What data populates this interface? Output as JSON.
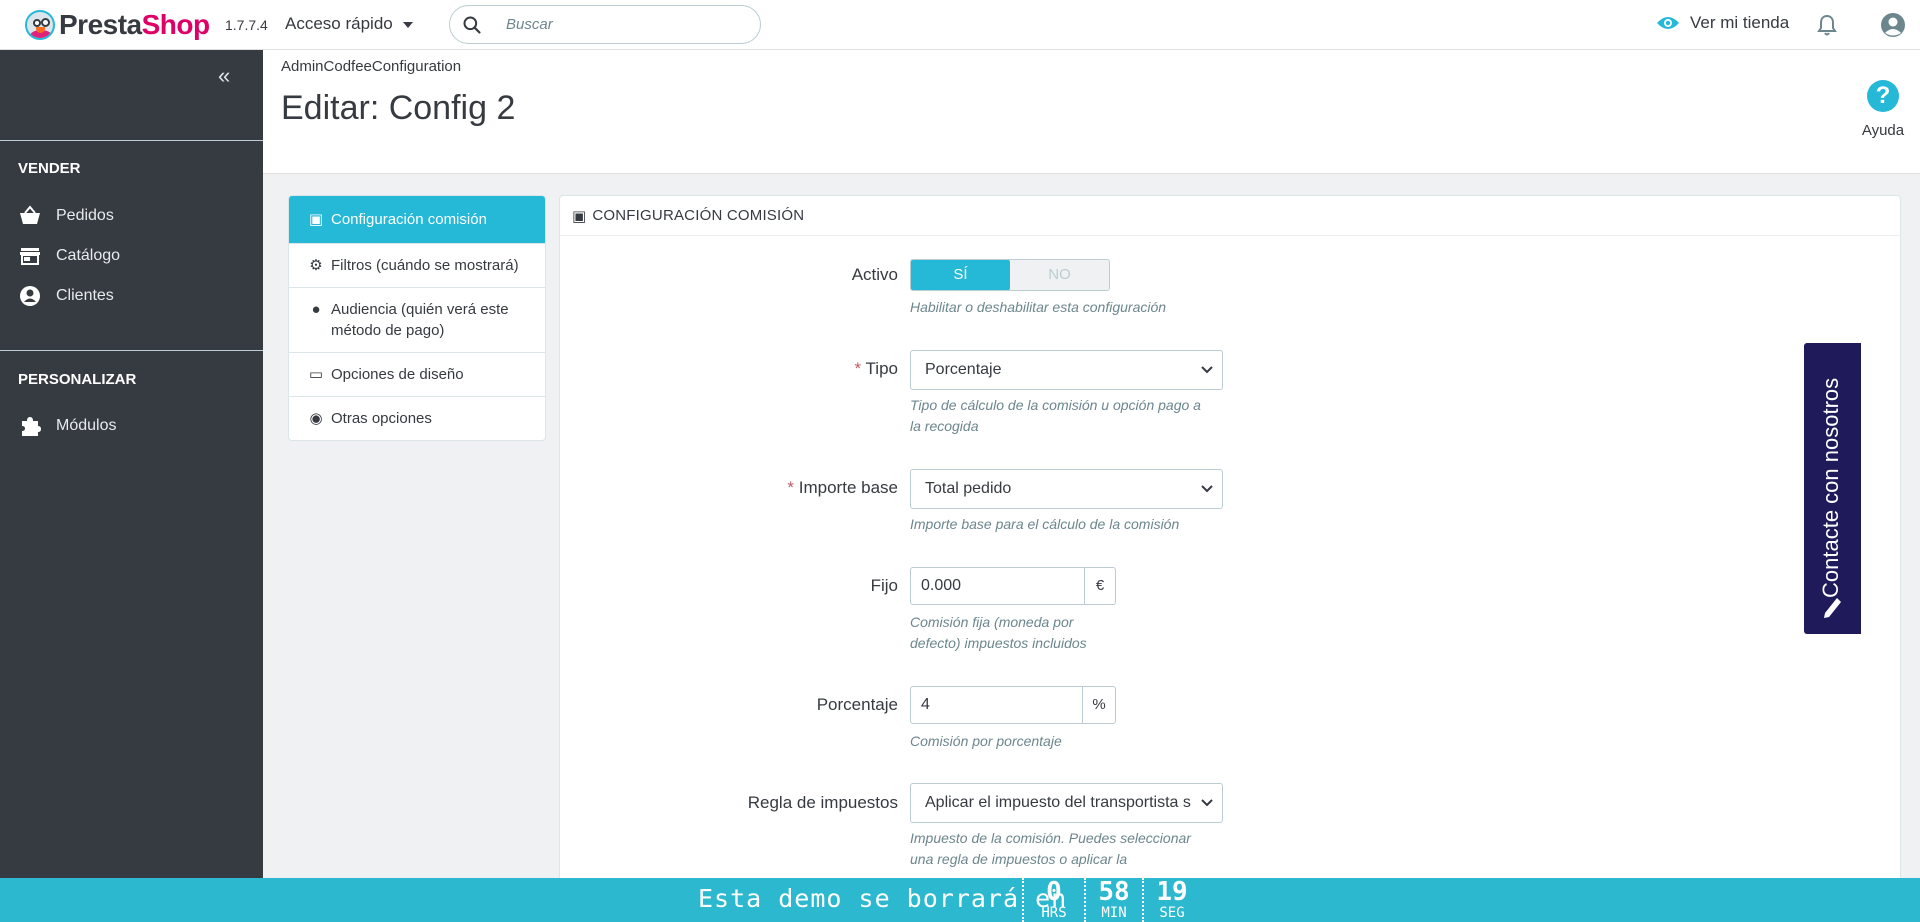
{
  "header": {
    "brand_part1": "Presta",
    "brand_part2": "Shop",
    "version": "1.7.7.4",
    "quick_access": "Acceso rápido",
    "search_placeholder": "Buscar",
    "view_shop": "Ver mi tienda"
  },
  "sidebar": {
    "section_sell": "VENDER",
    "items_sell": [
      {
        "label": "Pedidos",
        "icon": "basket-icon"
      },
      {
        "label": "Catálogo",
        "icon": "store-icon"
      },
      {
        "label": "Clientes",
        "icon": "account-icon"
      }
    ],
    "section_custom": "PERSONALIZAR",
    "items_custom": [
      {
        "label": "Módulos",
        "icon": "puzzle-icon"
      }
    ]
  },
  "page": {
    "breadcrumb": "AdminCodfeeConfiguration",
    "title": "Editar: Config 2",
    "help_label": "Ayuda"
  },
  "tabs": [
    {
      "label": "Configuración comisión",
      "active": true
    },
    {
      "label": "Filtros (cuándo se mostrará)",
      "active": false
    },
    {
      "label": "Audiencia (quién verá este método de pago)",
      "active": false
    },
    {
      "label": "Opciones de diseño",
      "active": false
    },
    {
      "label": "Otras opciones",
      "active": false
    }
  ],
  "panel": {
    "heading": "CONFIGURACIÓN COMISIÓN",
    "activo": {
      "label": "Activo",
      "on": "SÍ",
      "off": "NO",
      "value": "SÍ",
      "hint": "Habilitar o deshabilitar esta configuración"
    },
    "tipo": {
      "required": "*",
      "label": "Tipo",
      "value": "Porcentaje",
      "hint_line1": "Tipo de cálculo de la comisión u opción pago a",
      "hint_line2": "la recogida"
    },
    "importe": {
      "required": "*",
      "label": "Importe base",
      "value": "Total pedido",
      "hint": "Importe base para el cálculo de la comisión"
    },
    "fijo": {
      "label": "Fijo",
      "value": "0.000",
      "addon": "€",
      "hint_line1": "Comisión fija (moneda por",
      "hint_line2": "defecto) impuestos incluidos"
    },
    "porcentaje": {
      "label": "Porcentaje",
      "value": "4",
      "addon": "%",
      "hint": "Comisión por porcentaje"
    },
    "impuestos": {
      "label": "Regla de impuestos",
      "value": "Aplicar el impuesto del transportista s",
      "hint_line1": "Impuesto de la comisión. Puedes seleccionar",
      "hint_line2": "una regla de impuestos o aplicar la"
    }
  },
  "contact_tab": "Contacte con nosotros",
  "demo_banner": {
    "text": "Esta demo se borrará en",
    "hours": "0",
    "hours_label": "HRS",
    "minutes": "58",
    "minutes_label": "MIN",
    "seconds": "19",
    "seconds_label": "SEG"
  },
  "colors": {
    "accent": "#25b9d7",
    "sidebar": "#363a41",
    "brand_pink": "#df0067",
    "contact_bg": "#1f1a5a"
  }
}
